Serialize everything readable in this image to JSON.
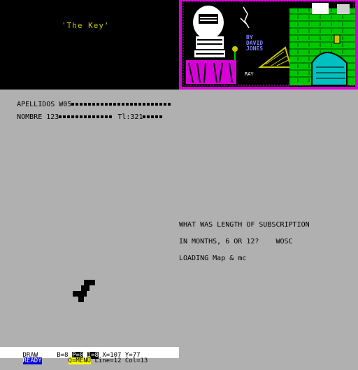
{
  "loading_screen": {
    "title": "'The Key'",
    "credit_by": "BY",
    "credit_name_1": "DAVID",
    "credit_name_2": "JONES",
    "ray_label": "RAY"
  },
  "fields": {
    "apellidos_label": "APELLIDOS W05",
    "nombre_label": "NOMBRE 123",
    "tl_label": "Tl:321"
  },
  "message": {
    "line1": "WHAT WAS LENGTH OF SUBSCRIPTION",
    "line2": "IN MONTHS, 6 OR 12?    WOSC",
    "line3": "LOADING Map & mc"
  },
  "status": {
    "mode": "DRAW",
    "b": "B=8",
    "p": "P=0",
    "i": "I=8",
    "x": "X=107",
    "y": "Y=77",
    "ready": "READY",
    "menu": "Q=MENU",
    "line": "Line=12",
    "col": "Col=13"
  },
  "colors": {
    "background": "#b0b0b0",
    "title": "#c8c800",
    "frame": "#d800d8",
    "ready": "#0000d8",
    "menu": "#ffff00"
  }
}
